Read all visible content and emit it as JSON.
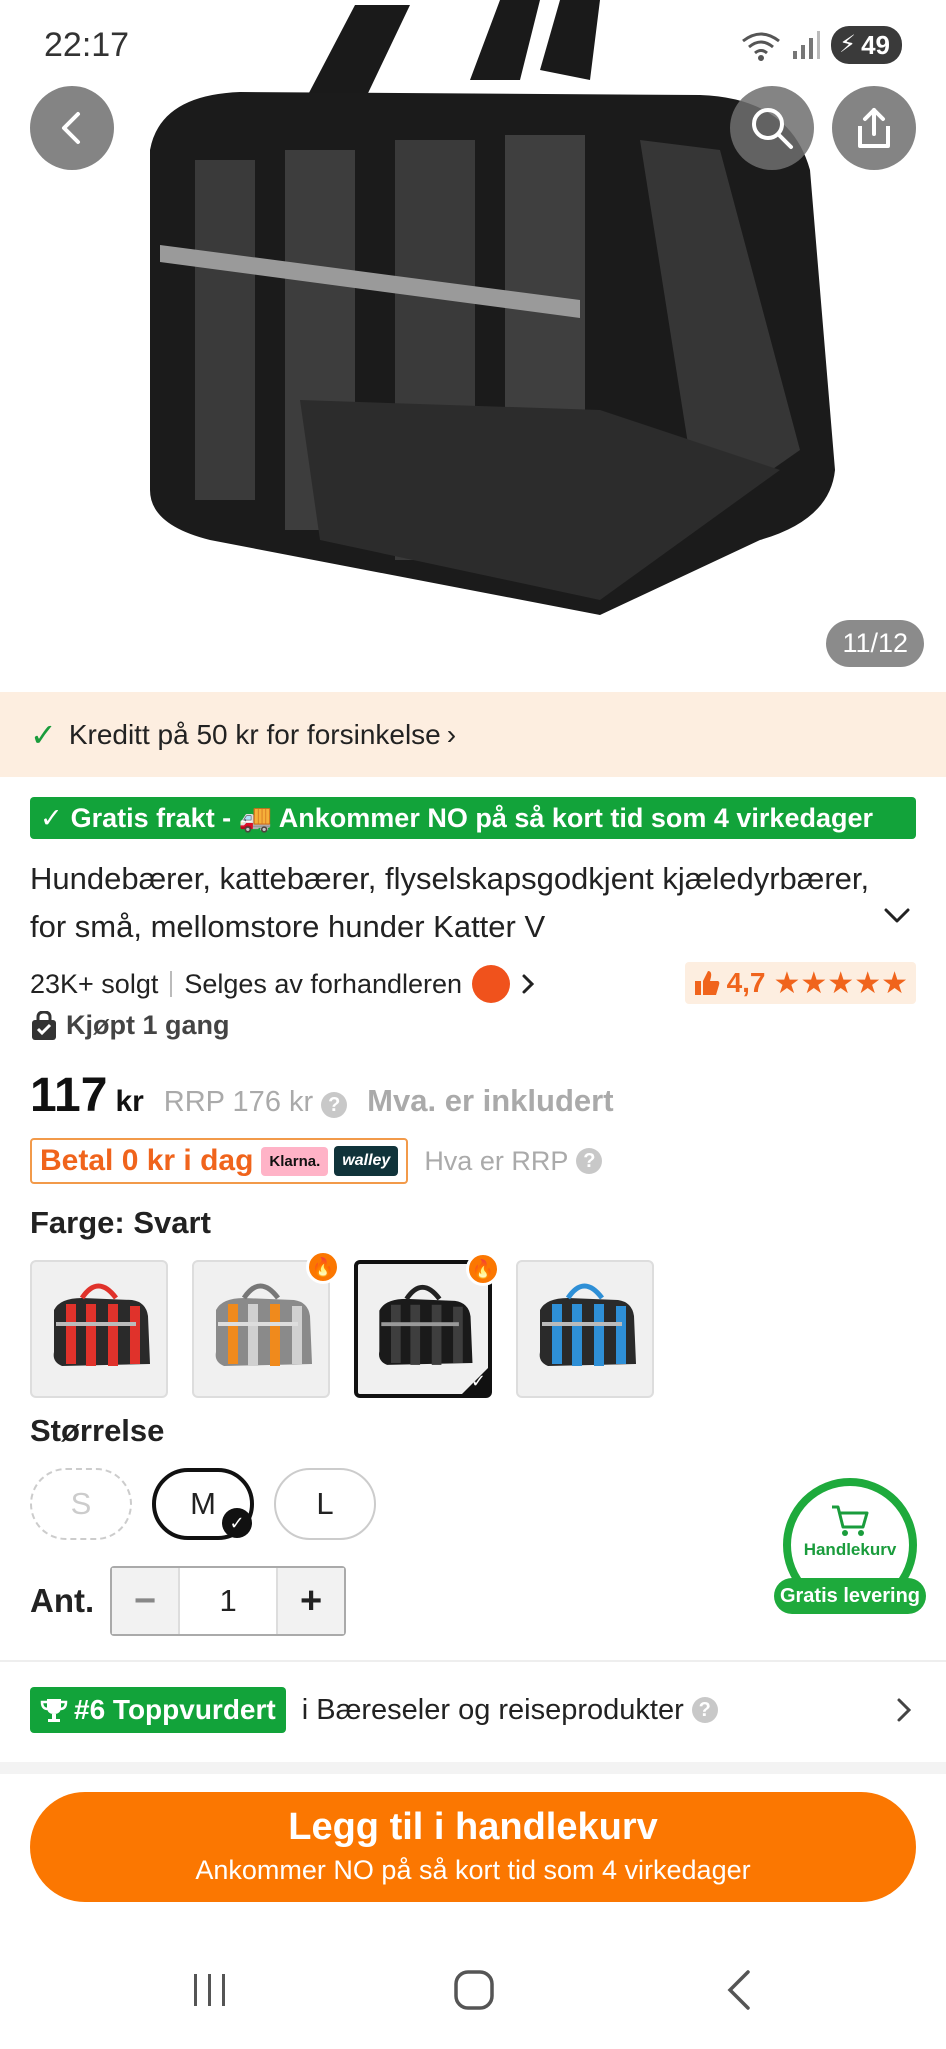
{
  "status_bar": {
    "time": "22:17",
    "battery": "49"
  },
  "hero": {
    "counter": "11/12"
  },
  "credit_banner": {
    "text": "Kreditt på 50 kr for forsinkelse",
    "arrow": "›"
  },
  "free_shipping": {
    "text": "Gratis frakt - 🚚 Ankommer NO på så kort tid som 4 virkedager"
  },
  "product": {
    "title": "Hundebærer, kattebærer, flyselskapsgodkjent kjæledyrbærer, for små, mellomstore hunder Katter V",
    "sold": "23K+ solgt",
    "seller": "Selges av forhandleren",
    "rating": "4,7",
    "stars": "★★★★★",
    "bought": "Kjøpt 1 gang"
  },
  "price": {
    "amount": "117",
    "currency": "kr",
    "rrp": "RRP 176 kr",
    "vat": "Mva. er inkludert",
    "pay_now": "Betal 0 kr i dag",
    "klarna": "Klarna.",
    "walley": "walley",
    "rrp_help": "Hva er RRP"
  },
  "color": {
    "label": "Farge: Svart",
    "options": [
      {
        "name": "Rød",
        "accent": "#e0322b"
      },
      {
        "name": "Grå",
        "accent": "#f08a1c"
      },
      {
        "name": "Svart",
        "accent": "#222222"
      },
      {
        "name": "Blå",
        "accent": "#2e8fd6"
      }
    ]
  },
  "size": {
    "label": "Størrelse",
    "options": [
      "S",
      "M",
      "L"
    ]
  },
  "quantity": {
    "label": "Ant.",
    "value": "1"
  },
  "cart_float": {
    "label": "Handlekurv",
    "pill": "Gratis levering"
  },
  "top_rated": {
    "badge": "#6 Toppvurdert",
    "text": "i Bæreseler og reiseprodukter"
  },
  "add_to_cart": {
    "label": "Legg til i handlekurv",
    "sub": "Ankommer NO på så kort tid som 4 virkedager"
  },
  "colors": {
    "accent": "#fb7701",
    "green": "#12a33a"
  }
}
